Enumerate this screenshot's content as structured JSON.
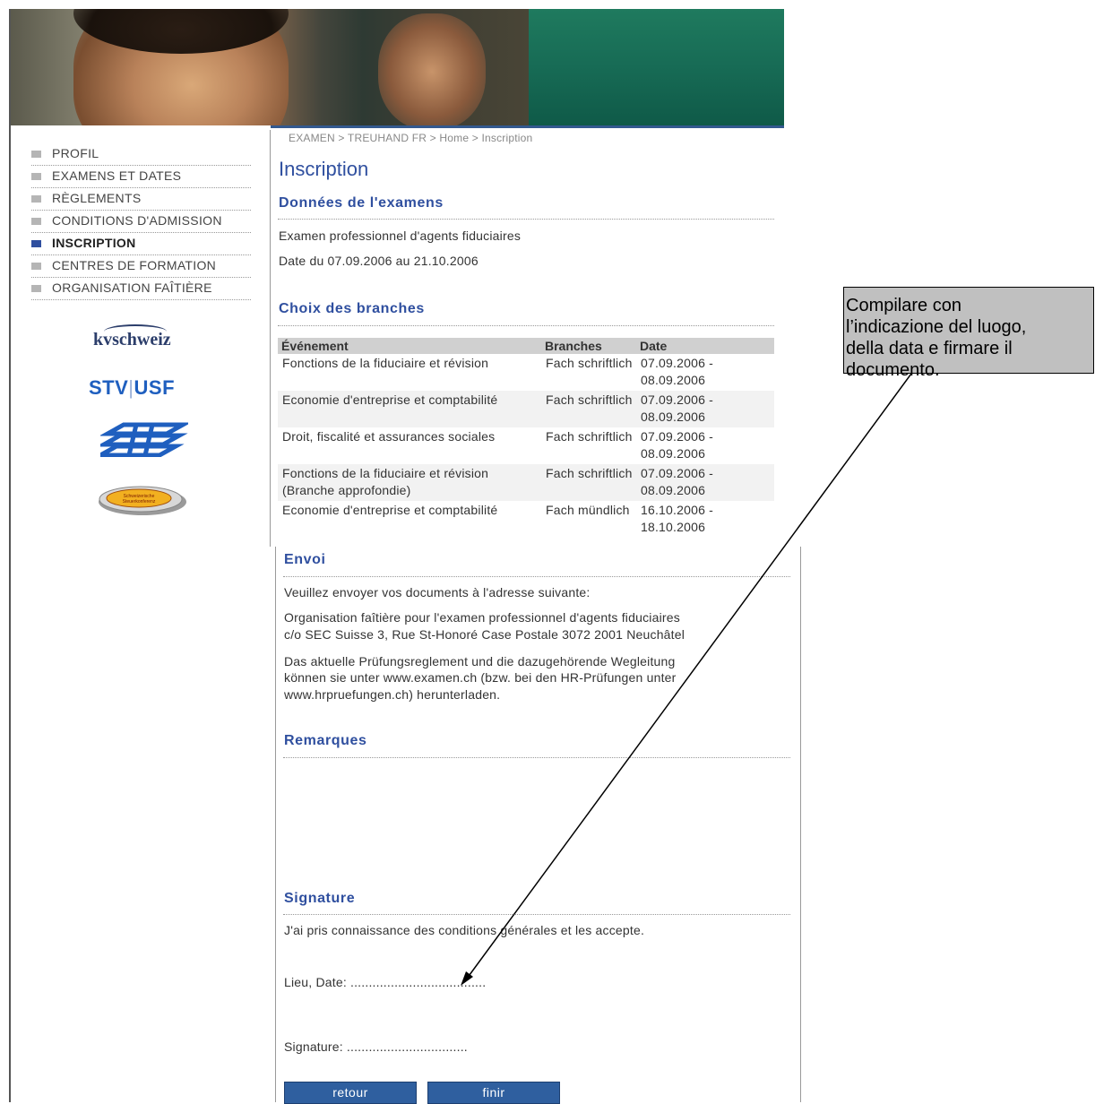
{
  "breadcrumb": "EXAMEN > TREUHAND FR > Home > Inscription",
  "page_title": "Inscription",
  "nav": {
    "items": [
      {
        "label": "PROFIL",
        "active": false
      },
      {
        "label": "EXAMENS ET DATES",
        "active": false
      },
      {
        "label": "RÈGLEMENTS",
        "active": false
      },
      {
        "label": "CONDITIONS D'ADMISSION",
        "active": false
      },
      {
        "label": "INSCRIPTION",
        "active": true
      },
      {
        "label": "CENTRES DE FORMATION",
        "active": false
      },
      {
        "label": "ORGANISATION FAÎTIÈRE",
        "active": false
      }
    ]
  },
  "logos": {
    "kv": "kvschweiz",
    "stv_left": "STV",
    "stv_sep": "|",
    "stv_right": "USF",
    "oval_line1": "Schweizerische",
    "oval_line2": "Steuerkonferenz"
  },
  "exam": {
    "heading": "Données de l'examens",
    "name": "Examen professionnel d'agents fiduciaires",
    "dates": "Date du 07.09.2006 au 21.10.2006"
  },
  "branches": {
    "heading": "Choix des branches",
    "columns": [
      "Événement",
      "Branches",
      "Date"
    ],
    "rows": [
      {
        "event": "Fonctions de la fiduciaire et révision",
        "branch": "Fach schriftlich",
        "date": "07.09.2006 - 08.09.2006"
      },
      {
        "event": "Economie d'entreprise et comptabilité",
        "branch": "Fach schriftlich",
        "date": "07.09.2006 - 08.09.2006"
      },
      {
        "event": "Droit, fiscalité et assurances sociales",
        "branch": "Fach schriftlich",
        "date": "07.09.2006 - 08.09.2006"
      },
      {
        "event": "Fonctions de la fiduciaire et révision (Branche approfondie)",
        "branch": "Fach schriftlich",
        "date": "07.09.2006 - 08.09.2006"
      },
      {
        "event": "Economie d'entreprise et comptabilité",
        "branch": "Fach mündlich",
        "date": "16.10.2006 - 18.10.2006"
      }
    ]
  },
  "envoi": {
    "heading": "Envoi",
    "p1": "Veuillez envoyer vos documents à l'adresse suivante:",
    "p2_line1": "Organisation faîtière pour l'examen professionnel d'agents fiduciaires",
    "p2_line2": "c/o SEC Suisse 3, Rue St-Honoré Case Postale 3072 2001 Neuchâtel",
    "p3_line1": "Das aktuelle Prüfungsreglement und die dazugehörende Wegleitung",
    "p3_line2": "können sie unter www.examen.ch (bzw. bei den HR-Prüfungen unter",
    "p3_line3": "www.hrpruefungen.ch) herunterladen."
  },
  "remarques": {
    "heading": "Remarques"
  },
  "signature": {
    "heading": "Signature",
    "accept": "J'ai pris connaissance des conditions générales et les accepte.",
    "place_date": "Lieu, Date: .....................................",
    "signature_line": "Signature: ................................."
  },
  "buttons": {
    "back": "retour",
    "finish": "finir"
  },
  "annotation": {
    "line1": "Compilare con",
    "line2": "l’indicazione del luogo,",
    "line3": "della data e firmare il",
    "line4": "documento."
  },
  "colors": {
    "accent": "#2f4f9f",
    "button": "#2f5f9f",
    "nav_inactive": "#b5b5b5",
    "table_header": "#d0d0d0",
    "banner_teal": "#176b55"
  }
}
